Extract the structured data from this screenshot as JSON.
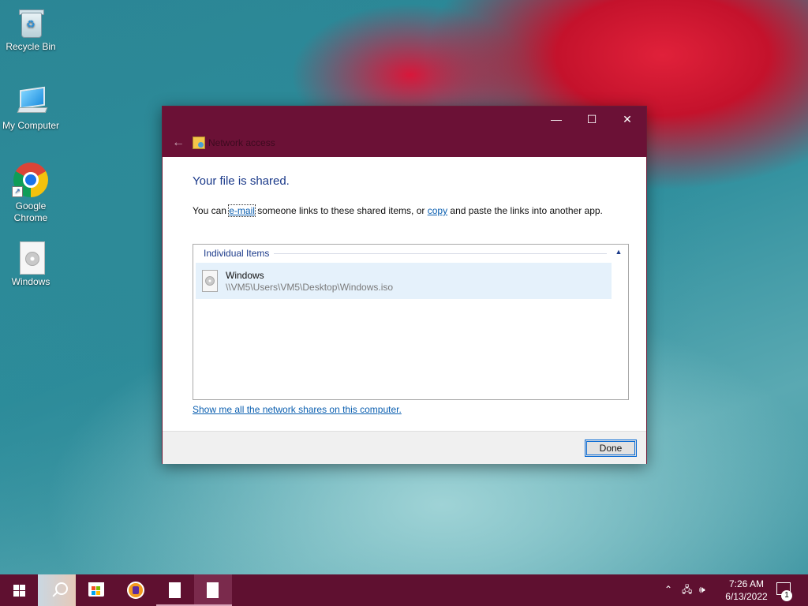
{
  "desktop": {
    "icons": [
      {
        "label": "Recycle Bin"
      },
      {
        "label": "My Computer"
      },
      {
        "label": "Google Chrome"
      },
      {
        "label": "Windows"
      }
    ]
  },
  "window": {
    "title": "Network access",
    "controls": {
      "minimize": "—",
      "maximize": "☐",
      "close": "✕"
    },
    "heading": "Your file is shared.",
    "description": {
      "prefix": "You can ",
      "email_link": "e-mail",
      "middle": " someone links to these shared items, or ",
      "copy_link": "copy",
      "suffix": " and paste the links into another app."
    },
    "group": {
      "label": "Individual Items",
      "items": [
        {
          "name": "Windows",
          "path": "\\\\VM5\\Users\\VM5\\Desktop\\Windows.iso"
        }
      ]
    },
    "shares_link": "Show me all the network shares on this computer.",
    "done_label": "Done"
  },
  "taskbar": {
    "clock_time": "7:26 AM",
    "clock_date": "6/13/2022",
    "notification_count": "1"
  }
}
